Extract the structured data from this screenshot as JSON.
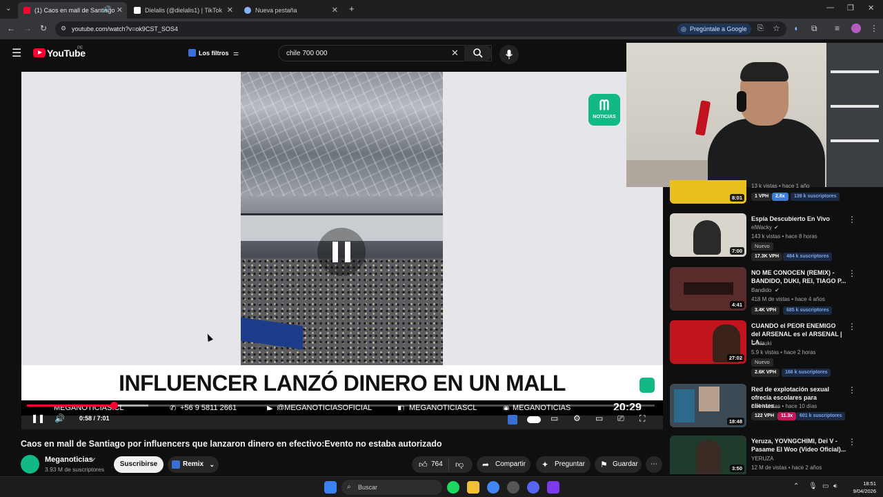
{
  "browser": {
    "tabs": [
      {
        "label": "(1) Caos en mall de Santiago",
        "favicon_color": "#ff0033"
      },
      {
        "label": "Dielalis (@dielalis1) | TikTok",
        "favicon_color": "#ffffff"
      },
      {
        "label": "Nueva pestaña",
        "favicon_color": "#8ab4f8"
      }
    ],
    "url": "youtube.com/watch?v=ok9CST_SOS4",
    "ask_google": "Pregúntale a Google"
  },
  "header": {
    "logo_text": "YouTube",
    "region": "PE",
    "filters_label": "Los filtros",
    "search_value": "chile 700 000"
  },
  "player": {
    "brand_logo": "NOTICIAS",
    "headline": "INFLUENCER LANZÓ DINERO EN UN MALL",
    "ticker": [
      "MEGANOTICIAS.CL",
      "+56 9 5811 2661",
      "@MEGANOTICIASOFICIAL",
      "MEGANOTICIASCL",
      "MEGANOTICIAS"
    ],
    "clock": "20:29",
    "time": "0:58 / 7:01",
    "progress": 0.138,
    "buffered": 0.193
  },
  "video": {
    "title": "Caos en mall de Santiago por influencers que lanzaron dinero en efectivo:Evento no estaba autorizado",
    "channel": "Meganoticias",
    "subscribers": "3.93 M de suscriptores",
    "subscribe_label": "Suscribirse",
    "remix_label": "Remix",
    "likes": "764",
    "share_label": "Compartir",
    "ask_label": "Preguntar",
    "save_label": "Guardar"
  },
  "sidebar": {
    "items": [
      {
        "title": "",
        "channel": "",
        "meta": "13 k vistas • hace 1 año",
        "duration": "8:01",
        "vph": "1 VPH",
        "ratio": "2.8x",
        "subs": "139 k suscriptores",
        "thumb": "#e8c120",
        "new": ""
      },
      {
        "title": "Espía Descubierto En Vivo",
        "channel": "elWacky",
        "meta": "143 k vistas • hace 8 horas",
        "duration": "7:00",
        "vph": "17.3K VPH",
        "ratio": "",
        "subs": "484 k suscriptores",
        "thumb": "#d9d4cc",
        "new": "Nuevo"
      },
      {
        "title": "NO ME CONOCEN (REMIX) - BANDIDO, DUKI, REI, TIAGO P...",
        "channel": "Bandido",
        "meta": "418 M de vistas • hace 4 años",
        "duration": "4:41",
        "vph": "3.4K VPH",
        "ratio": "",
        "subs": "685 k suscriptores",
        "thumb": "#5a2b2b",
        "new": ""
      },
      {
        "title": "CUANDO el PEOR ENEMIGO del ARSENAL es el ARSENAL | LA...",
        "channel": "Godzuki",
        "meta": "5.9 k vistas • hace 2 horas",
        "duration": "27:02",
        "vph": "2.6K VPH",
        "ratio": "",
        "subs": "166 k suscriptores",
        "thumb": "#c0151f",
        "new": "Nuevo"
      },
      {
        "title": "Red de explotación sexual ofrecía escolares para clientes...",
        "channel": "",
        "meta": "214 k vistas • hace 10 días",
        "duration": "18:48",
        "vph": "122 VPH",
        "ratio": "11.3x",
        "subs": "601 k suscriptores",
        "thumb": "#3c4a55",
        "new": ""
      },
      {
        "title": "Yeruza, YOVNGCHIMI, Dei V - Pasame El Woo (Video Oficial)...",
        "channel": "YERUZA",
        "meta": "12 M de vistas • hace 2 años",
        "duration": "3:50",
        "vph": "",
        "ratio": "",
        "subs": "",
        "thumb": "#1e3b2c",
        "new": ""
      }
    ]
  },
  "taskbar": {
    "search": "Buscar",
    "time": "18:51",
    "date": "9/04/2026"
  }
}
